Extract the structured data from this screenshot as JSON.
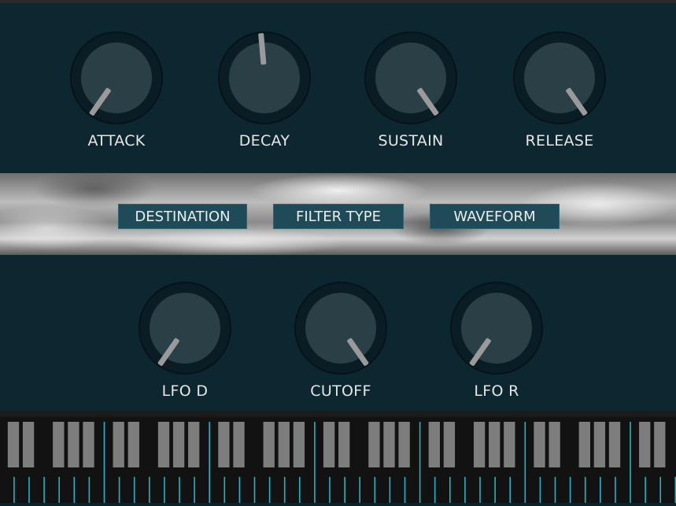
{
  "envelope": {
    "knobs": [
      {
        "label": "ATTACK",
        "angle": -145
      },
      {
        "label": "DECAY",
        "angle": -5
      },
      {
        "label": "SUSTAIN",
        "angle": 145
      },
      {
        "label": "RELEASE",
        "angle": 145
      }
    ]
  },
  "selectors": {
    "destination": "DESTINATION",
    "filter_type": "FILTER TYPE",
    "waveform": "WAVEFORM"
  },
  "modulation": {
    "knobs": [
      {
        "label": "LFO D",
        "angle": -145
      },
      {
        "label": "CUTOFF",
        "angle": 145
      },
      {
        "label": "LFO R",
        "angle": -145
      }
    ]
  },
  "colors": {
    "panel": "#0d2730",
    "knob_pointer": "#9a9a9a",
    "selector": "#1f4b58",
    "key_line": "#1fb5c7"
  }
}
